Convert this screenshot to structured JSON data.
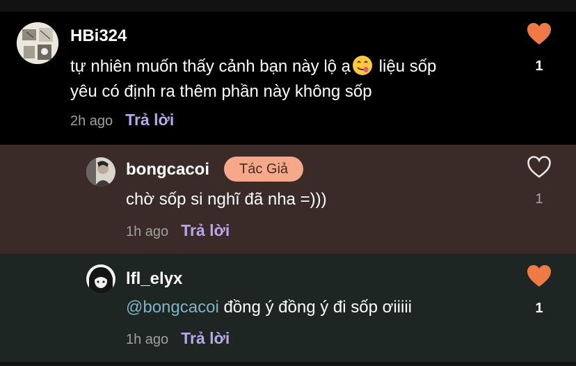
{
  "comments": [
    {
      "username": "HBi324",
      "avatar": "manga-panel-avatar",
      "text_line1_before_emoji": "tự nhiên muốn thấy cảnh bạn này lộ ạ",
      "emoji": "face-savoring-food-emoji",
      "text_line1_after_emoji": " liệu sốp",
      "text_line2": "yêu có định ra thêm phần này không sốp",
      "time": "2h ago",
      "reply_label": "Trả lời",
      "likes": "1",
      "liked": true
    },
    {
      "username": "bongcacoi",
      "avatar": "photo-avatar",
      "badge": "Tác Giả",
      "text": "chờ sốp si nghĩ đã nha =)))",
      "time": "1h ago",
      "reply_label": "Trả lời",
      "likes": "1",
      "liked": false
    },
    {
      "username": "lfl_elyx",
      "avatar": "anime-character-avatar",
      "mention": "@bongcacoi",
      "text": " đồng ý đồng ý đi sốp ơiiiii",
      "time": "1h ago",
      "reply_label": "Trả lời",
      "likes": "1",
      "liked": true
    }
  ],
  "colors": {
    "heart_active": "#f07a45",
    "reply_link": "#b9a6ec",
    "mention": "#7fb3c5",
    "author_badge_bg": "#f6a98a"
  }
}
